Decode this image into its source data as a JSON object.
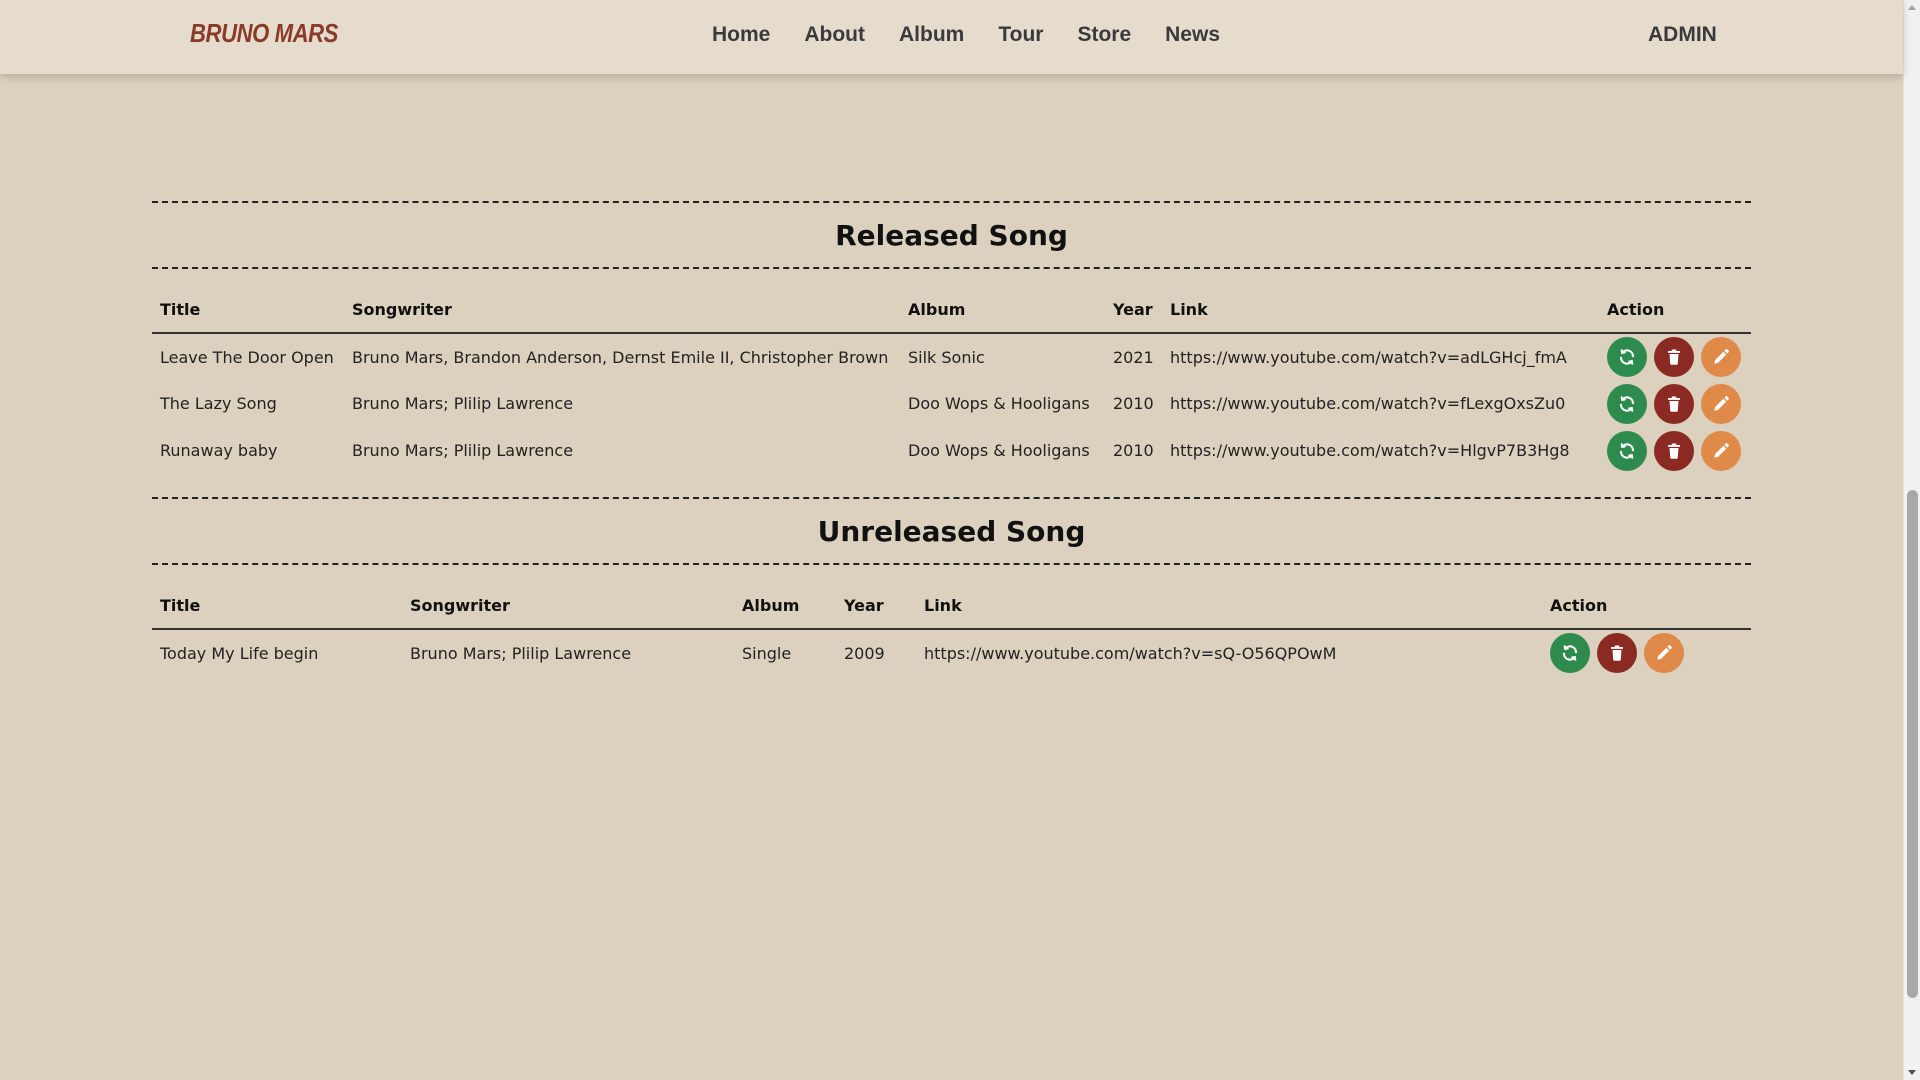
{
  "header": {
    "logo": "BRUNO MARS",
    "nav": [
      "Home",
      "About",
      "Album",
      "Tour",
      "Store",
      "News"
    ],
    "admin": "ADMIN"
  },
  "released": {
    "title": "Released Song",
    "columns": [
      "Title",
      "Songwriter",
      "Album",
      "Year",
      "Link",
      "Action"
    ],
    "rows": [
      {
        "title": "Leave The Door Open",
        "songwriter": "Bruno Mars, Brandon Anderson, Dernst Emile II, Christopher Brown",
        "album": "Silk Sonic",
        "year": "2021",
        "link": "https://www.youtube.com/watch?v=adLGHcj_fmA"
      },
      {
        "title": "The Lazy Song",
        "songwriter": "Bruno Mars; Plilip Lawrence",
        "album": "Doo Wops & Hooligans",
        "year": "2010",
        "link": "https://www.youtube.com/watch?v=fLexgOxsZu0"
      },
      {
        "title": "Runaway baby",
        "songwriter": "Bruno Mars; Plilip Lawrence",
        "album": "Doo Wops & Hooligans",
        "year": "2010",
        "link": "https://www.youtube.com/watch?v=HlgvP7B3Hg8"
      }
    ]
  },
  "unreleased": {
    "title": "Unreleased Song",
    "columns": [
      "Title",
      "Songwriter",
      "Album",
      "Year",
      "Link",
      "Action"
    ],
    "rows": [
      {
        "title": "Today My Life begin",
        "songwriter": "Bruno Mars; Plilip Lawrence",
        "album": "Single",
        "year": "2009",
        "link": "https://www.youtube.com/watch?v=sQ-O56QPOwM"
      }
    ]
  },
  "colors": {
    "background": "#dcd1bf",
    "header": "#e5dccd",
    "logo": "#8b3a2a",
    "refresh": "#2e8b4e",
    "delete": "#8b2a22",
    "edit": "#e08a4a"
  },
  "icons": {
    "refresh": "refresh-icon",
    "delete": "trash-icon",
    "edit": "pencil-icon"
  }
}
